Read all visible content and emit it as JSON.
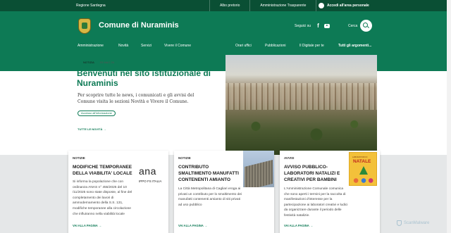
{
  "topbar": {
    "region": "Regione Sardegna",
    "links": [
      "Albo pretorio",
      "Amministrazione Trasparente"
    ],
    "login": "Accedi all'area personale"
  },
  "header": {
    "site_title": "Comune di Nuraminis",
    "social_label": "Seguici su",
    "search_label": "Cerca"
  },
  "nav": {
    "left": [
      "Amministrazione",
      "Novità",
      "Servizi",
      "Vivere il Comune"
    ],
    "right": [
      "Orari uffici",
      "Pubblicazioni",
      "Il Digitale per te",
      "Tutti gli argomenti..."
    ]
  },
  "hero": {
    "badge": "NOTIZIA",
    "date": "03 MAG 24",
    "title": "Benvenuti nel sito istituzionale di Nuraminis",
    "description": "Per scoprire tutte le news, i comunicati e gli avvisi del Comune visita le sezioni Novità e Vivere il Comune.",
    "chip": "Accesso all'informazione",
    "all_news": "TUTTE LE NOVITÀ"
  },
  "cards": [
    {
      "category": "NOTIZIE",
      "title": "MODIFICHE TEMPORANEE DELLA VIABILITA' LOCALE",
      "text": "Si informa la popolazione che con ordinanza ANAS n° 455/2025 del 10 /11/2025 sono state disposte, al fine del completamento dei lavori di ammodernamento della S.S. 131, modifiche temporanee alla circolazione che influiranno nella viabilità locale",
      "logo_text": "ana",
      "logo_sub": "IPPO FS ITALIA",
      "more": "VAI ALLA PAGINA"
    },
    {
      "category": "NOTIZIE",
      "title": "CONTRIBUTO SMALTIMENTO MANUFATTI CONTENENTI AMIANTO",
      "text": "La Città Metropolitana di Cagliari eroga ai privati un contributo per lo smaltimento dei manufatti contenenti amianto di siti privati ad uso pubblico",
      "more": "VAI ALLA PAGINA"
    },
    {
      "category": "AVVISI",
      "title": "AVVISO PUBBLICO- LABORATORI NATALIZI E CREATIVI PER BAMBINI",
      "text": "L'Amministrazione Comunale comunica che sono aperti i termini per la raccolta di manifestazioni d'interesse per la partecipazione ai laboratori creativi e ludici da organizzare durante il periodo delle festività natalizie.",
      "poster_top": "LABORATORI DI",
      "poster_title": "NATALE",
      "more": "VAI ALLA PAGINA"
    }
  ],
  "watermark": "ScanMalware",
  "colors": {
    "brand_green": "#0d7a55",
    "dark_green": "#0a4f34",
    "band_gray": "#e5e7e8"
  }
}
